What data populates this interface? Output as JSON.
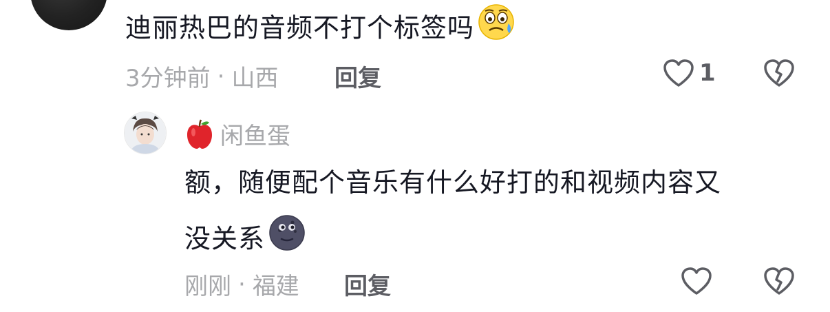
{
  "parent_comment": {
    "text": "迪丽热巴的音频不打个标签吗",
    "time": "3分钟前",
    "location": "山西",
    "separator": "·",
    "reply_label": "回复",
    "like_count": "1",
    "emoji": "anxious-sweat-face-emoji"
  },
  "reply_comment": {
    "username": "闲鱼蛋",
    "badge_icon": "apple-icon",
    "text_line1": "额，随便配个音乐有什么好打的和视频内容又",
    "text_line2": "没关系",
    "time": "刚刚",
    "location": "福建",
    "separator": "·",
    "reply_label": "回复",
    "emoji": "new-moon-face-emoji"
  },
  "colors": {
    "text_primary": "#161823",
    "text_secondary": "#a7a8ab",
    "action_gray": "#5c5d63"
  }
}
